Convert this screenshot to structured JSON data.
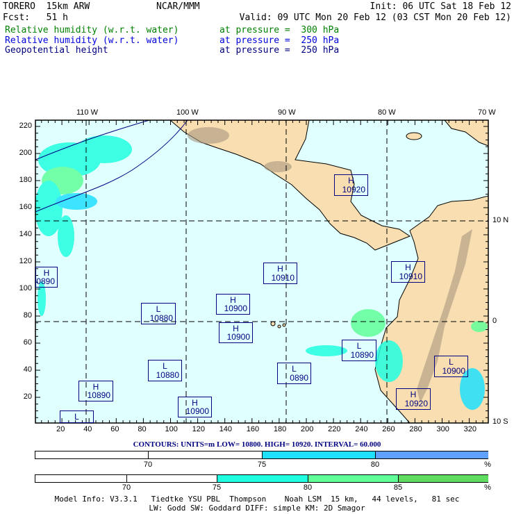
{
  "header": {
    "model": "TORERO  15km ARW",
    "org": "NCAR/MMM",
    "init": "Init: 06 UTC Sat 18 Feb 12",
    "fcst": "Fcst:   51 h",
    "valid": "Valid: 09 UTC Mon 20 Feb 12 (03 CST Mon 20 Feb 12)",
    "fields": [
      {
        "name": "Relative humidity (w.r.t. water)",
        "level": "at pressure =  300 hPa",
        "color": "#008000"
      },
      {
        "name": "Relative humidity (w.r.t. water)",
        "level": "at pressure =  250 hPa",
        "color": "#0000dd"
      },
      {
        "name": "Geopotential height",
        "level": "at pressure =  250 hPa",
        "color": "#000080"
      }
    ]
  },
  "map": {
    "top_lon_labels": [
      "110 W",
      "100 W",
      "90 W",
      "80 W",
      "70 W"
    ],
    "right_lat_labels": [
      "10 N",
      "0",
      "10 S"
    ],
    "left_ticks": [
      "20",
      "40",
      "60",
      "80",
      "100",
      "120",
      "140",
      "160",
      "180",
      "200",
      "220"
    ],
    "bottom_ticks": [
      "20",
      "40",
      "60",
      "80",
      "100",
      "120",
      "140",
      "160",
      "180",
      "200",
      "220",
      "240",
      "260",
      "280",
      "300",
      "320"
    ],
    "centers": [
      {
        "type": "H",
        "value": "0890"
      },
      {
        "type": "L",
        "value": "10880"
      },
      {
        "type": "H",
        "value": "10900"
      },
      {
        "type": "H",
        "value": "10900"
      },
      {
        "type": "L",
        "value": "10880"
      },
      {
        "type": "H",
        "value": "10890"
      },
      {
        "type": "L",
        "value": ""
      },
      {
        "type": "H",
        "value": "10900"
      },
      {
        "type": "H",
        "value": "10920"
      },
      {
        "type": "H",
        "value": "10910"
      },
      {
        "type": "H",
        "value": "10910"
      },
      {
        "type": "L",
        "value": "10890"
      },
      {
        "type": "L",
        "value": "0890"
      },
      {
        "type": "L",
        "value": "10900"
      },
      {
        "type": "H",
        "value": "10920"
      }
    ],
    "colors": {
      "ocean": "#e0ffff",
      "land": "#f8deb0",
      "contour": "#000080"
    }
  },
  "contours": "CONTOURS:  UNITS=m  LOW=  10800.      HIGH=  10920.      INTERVAL=    60.000",
  "colorbar1": {
    "labels": [
      "70",
      "75",
      "80"
    ],
    "unit": "%",
    "colors": [
      "#ffffff",
      "#ffffff",
      "#20e0ff",
      "#60a0ff"
    ]
  },
  "colorbar2": {
    "labels": [
      "70",
      "75",
      "80",
      "85"
    ],
    "unit": "%",
    "colors": [
      "#ffffff",
      "#ffffff",
      "#20ffe0",
      "#60ff98",
      "#60dd60"
    ]
  },
  "footer": {
    "line1": "Model Info: V3.3.1   Tiedtke YSU PBL  Thompson    Noah LSM  15 km,   44 levels,   81 sec",
    "line2": "LW: Godd SW: Goddard DIFF: simple KM: 2D Smagor"
  }
}
